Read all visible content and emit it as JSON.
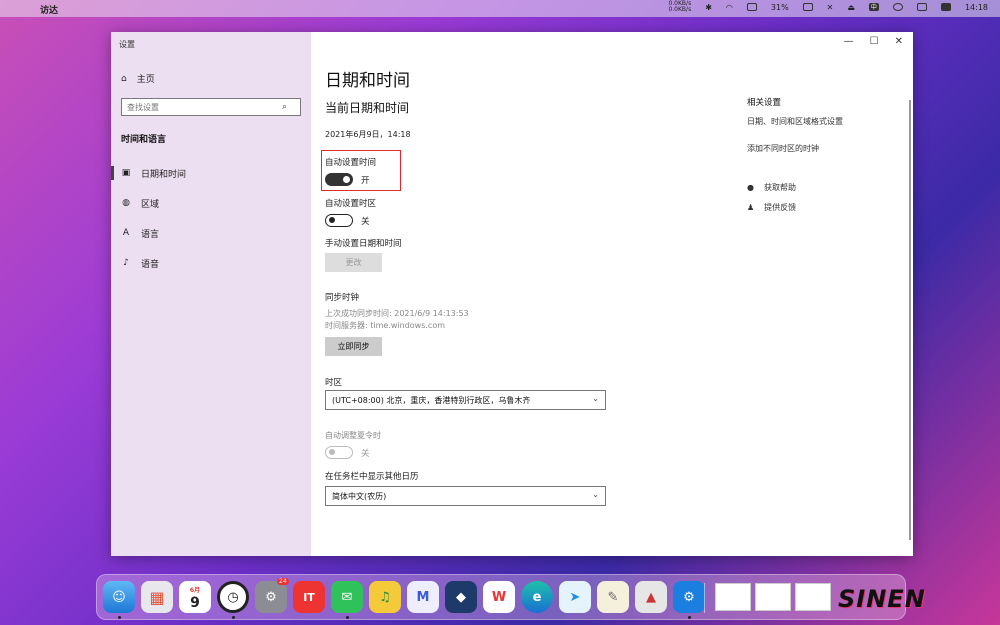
{
  "menubar": {
    "app_name": "访达",
    "net_up": "0.0KB/s",
    "net_down": "0.0KB/s",
    "battery": "31%",
    "input_method": "中",
    "time": "14:18"
  },
  "window": {
    "title": "设置",
    "controls": {
      "minimize": "—",
      "maximize": "☐",
      "close": "✕"
    }
  },
  "sidebar": {
    "home": "主页",
    "search_placeholder": "查找设置",
    "section": "时间和语言",
    "items": [
      {
        "label": "日期和时间",
        "icon": "calendar-clock-icon"
      },
      {
        "label": "区域",
        "icon": "globe-icon"
      },
      {
        "label": "语言",
        "icon": "language-icon"
      },
      {
        "label": "语音",
        "icon": "microphone-icon"
      }
    ]
  },
  "main": {
    "title": "日期和时间",
    "subtitle": "当前日期和时间",
    "current_datetime": "2021年6月9日，14:18",
    "auto_time": {
      "label": "自动设置时间",
      "state": "开"
    },
    "auto_timezone": {
      "label": "自动设置时区",
      "state": "关"
    },
    "manual": {
      "label": "手动设置日期和时间",
      "button": "更改"
    },
    "sync": {
      "label": "同步时钟",
      "last_sync": "上次成功同步时间: 2021/6/9 14:13:53",
      "server": "时间服务器: time.windows.com",
      "button": "立即同步"
    },
    "timezone": {
      "label": "时区",
      "value": "(UTC+08:00) 北京，重庆，香港特别行政区，乌鲁木齐"
    },
    "dst": {
      "label": "自动调整夏令时",
      "state": "关"
    },
    "calendar": {
      "label": "在任务栏中显示其他日历",
      "value": "简体中文(农历)"
    }
  },
  "related": {
    "title": "相关设置",
    "links": [
      "日期、时间和区域格式设置",
      "添加不同时区的时钟"
    ],
    "help": "获取帮助",
    "feedback": "提供反馈"
  },
  "dock": {
    "calendar_month": "6月",
    "calendar_day": "9",
    "badge": "24",
    "apps": [
      "finder",
      "launchpad",
      "calendar",
      "clock",
      "system-preferences",
      "news",
      "wechat",
      "music",
      "meitu",
      "qq",
      "wps",
      "edge",
      "messenger",
      "notes",
      "office-toolkit",
      "settings"
    ]
  },
  "watermark": "SINEN"
}
